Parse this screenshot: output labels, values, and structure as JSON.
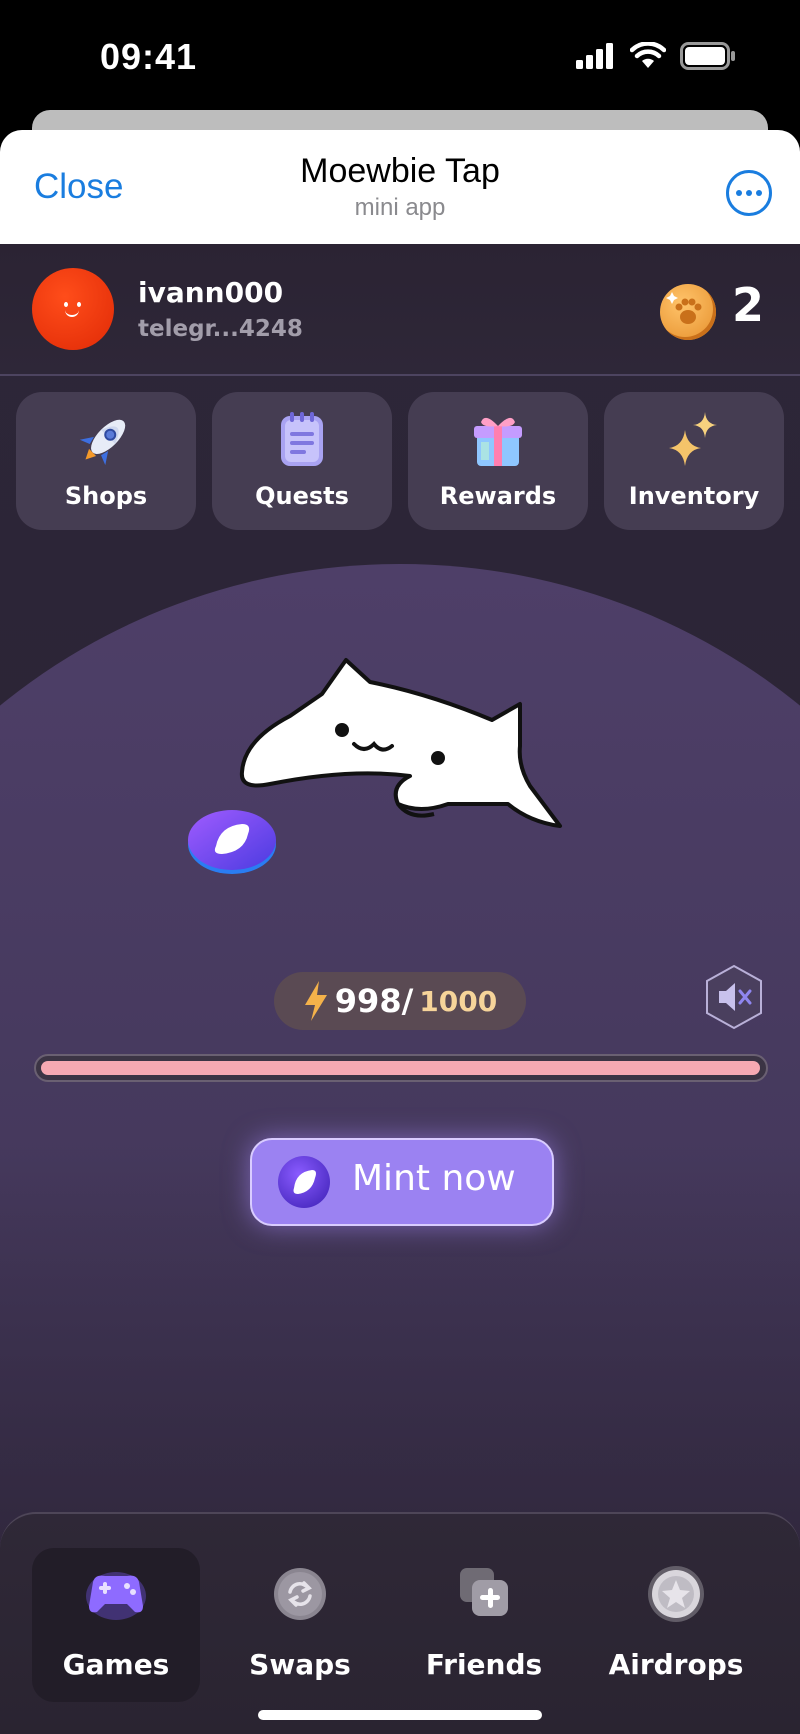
{
  "status_bar": {
    "time": "09:41"
  },
  "header": {
    "close_label": "Close",
    "title": "Moewbie Tap",
    "subtitle": "mini app"
  },
  "user": {
    "name": "ivann000",
    "handle": "telegr...4248",
    "coin_count": "2"
  },
  "menu": [
    {
      "label": "Shops",
      "icon": "rocket-icon"
    },
    {
      "label": "Quests",
      "icon": "notepad-icon"
    },
    {
      "label": "Rewards",
      "icon": "gift-icon"
    },
    {
      "label": "Inventory",
      "icon": "sparkles-icon"
    }
  ],
  "energy": {
    "current": "998/",
    "max": "1000",
    "fraction": 0.998
  },
  "mint_label": "Mint now",
  "nav": [
    {
      "label": "Games",
      "icon": "gamepad-icon",
      "active": true
    },
    {
      "label": "Swaps",
      "icon": "swap-icon",
      "active": false
    },
    {
      "label": "Friends",
      "icon": "add-friend-icon",
      "active": false
    },
    {
      "label": "Airdrops",
      "icon": "airdrop-coin-icon",
      "active": false
    }
  ],
  "colors": {
    "accent": "#1a7ddf",
    "background": "#2d2638",
    "mint_button": "#9b82f2",
    "progress_fill": "#f6a9b2"
  }
}
